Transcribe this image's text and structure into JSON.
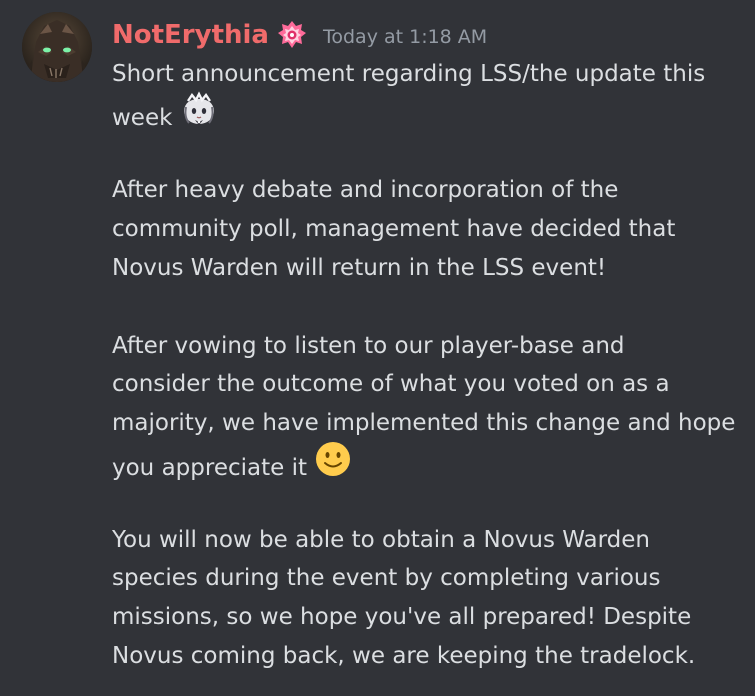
{
  "message": {
    "author": "NotErythia",
    "timestamp": "Today at 1:18 AM",
    "paragraphs": [
      {
        "lines": [
          "Short announcement regarding LSS/the update this",
          "week"
        ]
      },
      {
        "lines": [
          "After heavy debate and incorporation of the",
          "community poll, management have decided that",
          "Novus Warden will return in the LSS event!"
        ]
      },
      {
        "lines": [
          "After vowing to listen to our player-base and",
          "consider the outcome of what you voted on as a",
          "majority, we have implemented this change and hope",
          "you appreciate it"
        ]
      },
      {
        "lines": [
          "You will now be able to obtain a Novus Warden",
          "species during the event by completing various",
          "missions, so we hope you've all prepared! Despite",
          "Novus coming back, we are keeping the tradelock."
        ]
      }
    ]
  },
  "icons": {
    "avatar": "avatar-image",
    "role_badge": "role-badge-icon",
    "custom_emoji": "maid-character-emoji",
    "smile_emoji": "slightly-smiling-face-emoji"
  },
  "colors": {
    "background": "#313338",
    "username": "#f06b6b",
    "timestamp": "#949ba4",
    "text": "#dbdee1"
  }
}
